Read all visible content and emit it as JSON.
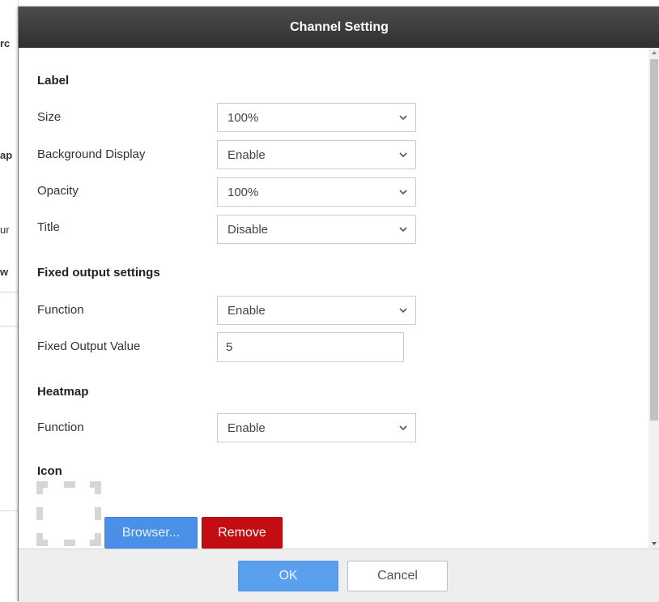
{
  "background_fragments": [
    "rc",
    "ap",
    "ur",
    "w"
  ],
  "dialog": {
    "title": "Channel Setting",
    "sections": {
      "label": {
        "title": "Label",
        "size": {
          "label": "Size",
          "value": "100%"
        },
        "background_display": {
          "label": "Background Display",
          "value": "Enable"
        },
        "opacity": {
          "label": "Opacity",
          "value": "100%"
        },
        "title_field": {
          "label": "Title",
          "value": "Disable"
        }
      },
      "fixed_output": {
        "title": "Fixed output settings",
        "function": {
          "label": "Function",
          "value": "Enable"
        },
        "fixed_output_value": {
          "label": "Fixed Output Value",
          "value": "5"
        }
      },
      "heatmap": {
        "title": "Heatmap",
        "function": {
          "label": "Function",
          "value": "Enable"
        }
      },
      "icon": {
        "title": "Icon",
        "browse_label": "Browser...",
        "remove_label": "Remove"
      }
    },
    "footer": {
      "ok_label": "OK",
      "cancel_label": "Cancel"
    }
  },
  "colors": {
    "header_bg": "#3b3b3b",
    "primary_button": "#4a90e8",
    "danger_button": "#c30d12"
  }
}
